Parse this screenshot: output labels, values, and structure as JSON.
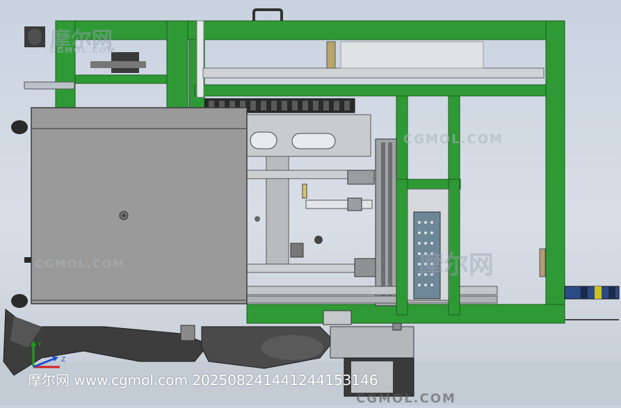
{
  "watermarks": {
    "logo_top": "摩尔网",
    "logo_top_sub": "CGMOL.COM",
    "right_mid": "CGMOL.COM",
    "center_cn": "摩尔网",
    "left_mid": "CGMOL.COM",
    "bottom_right": "CGMOL.COM"
  },
  "caption": {
    "text": "摩尔网 www.cgmol.com 202508241441244153146"
  },
  "triad": {
    "y_label": "Y",
    "z_label": "Z"
  },
  "colors": {
    "frame_green": "#2f9a35",
    "frame_green_dark": "#1f6e24",
    "panel_gray": "#9a9a9a",
    "background": "#d2d9e2"
  }
}
